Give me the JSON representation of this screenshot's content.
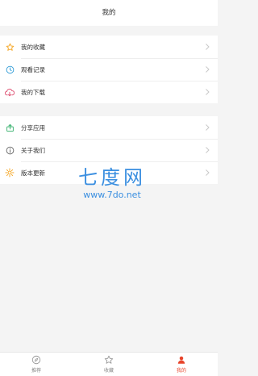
{
  "header": {
    "title": "我的"
  },
  "menu_group_1": [
    {
      "label": "我的收藏",
      "icon": "star-icon",
      "color": "#f5a623"
    },
    {
      "label": "观看记录",
      "icon": "clock-icon",
      "color": "#2f9bd6"
    },
    {
      "label": "我的下载",
      "icon": "cloud-download-icon",
      "color": "#e05a7a"
    }
  ],
  "menu_group_2": [
    {
      "label": "分享应用",
      "icon": "share-icon",
      "color": "#3cb371"
    },
    {
      "label": "关于我们",
      "icon": "info-icon",
      "color": "#666666"
    },
    {
      "label": "版本更新",
      "icon": "sun-icon",
      "color": "#f5a623"
    }
  ],
  "watermark": {
    "title": "七度网",
    "url": "www.7do.net"
  },
  "tabbar": {
    "tabs": [
      {
        "label": "推荐",
        "icon": "compass-icon",
        "active": false
      },
      {
        "label": "收藏",
        "icon": "star-outline-icon",
        "active": false
      },
      {
        "label": "我的",
        "icon": "user-icon",
        "active": true
      }
    ],
    "active_color": "#e8452c"
  }
}
